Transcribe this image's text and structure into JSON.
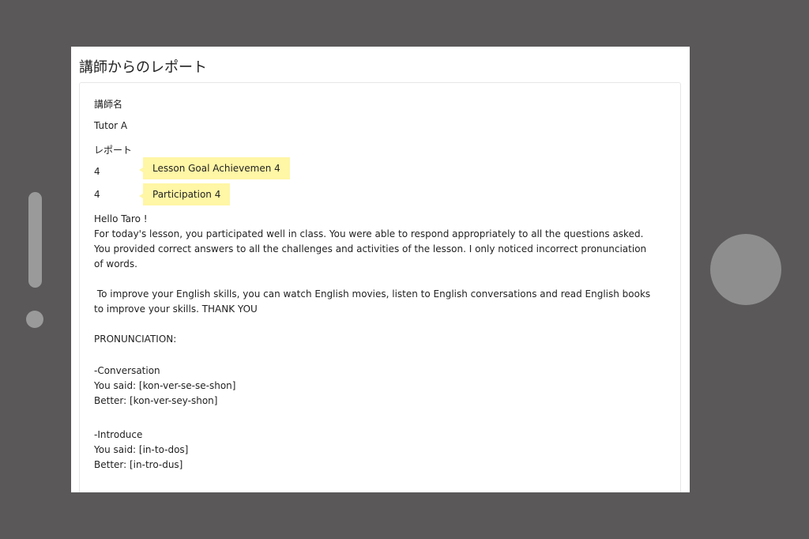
{
  "page": {
    "title": "講師からのレポート"
  },
  "report": {
    "tutor_name_label": "講師名",
    "tutor_name": "Tutor A",
    "report_label": "レポート",
    "score1": "4",
    "score1_callout": "Lesson Goal Achievemen 4",
    "score2": "4",
    "score2_callout": "Participation 4",
    "greeting": "Hello Taro !",
    "para1": "For today's lesson, you participated well in class. You were able to respond appropriately to all the questions asked. You provided correct answers to all the challenges and activities of the lesson. I only noticed incorrect pronunciation of words.",
    "para2": " To improve your English skills, you can watch English movies, listen to English conversations and read English books to improve your skills. THANK YOU",
    "pron_heading": "PRONUNCIATION:",
    "items": [
      {
        "word": "-Conversation",
        "said": "You said: [kon-ver-se-se-shon]",
        "better": "Better: [kon-ver-sey-shon]"
      },
      {
        "word": "-Introduce",
        "said": "You said: [in-to-dos]",
        "better": "Better: [in-tro-dus]"
      }
    ]
  }
}
